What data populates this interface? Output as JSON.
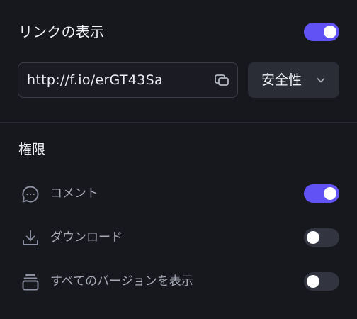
{
  "link_display": {
    "title": "リンクの表示",
    "enabled": true,
    "url": "http://f.io/erGT43Sa",
    "copy_icon": "copy-icon",
    "security_label": "安全性",
    "security_icon": "chevron-down-icon"
  },
  "permissions": {
    "heading": "権限",
    "items": [
      {
        "label": "コメント",
        "icon": "comment-icon",
        "enabled": true
      },
      {
        "label": "ダウンロード",
        "icon": "download-icon",
        "enabled": false
      },
      {
        "label": "すべてのバージョンを表示",
        "icon": "versions-icon",
        "enabled": false
      }
    ]
  },
  "colors": {
    "background": "#17181e",
    "accent": "#6152f5",
    "toggle_off": "#32343f",
    "text_primary": "#f1f2f6",
    "text_secondary": "#a7a9b6"
  }
}
